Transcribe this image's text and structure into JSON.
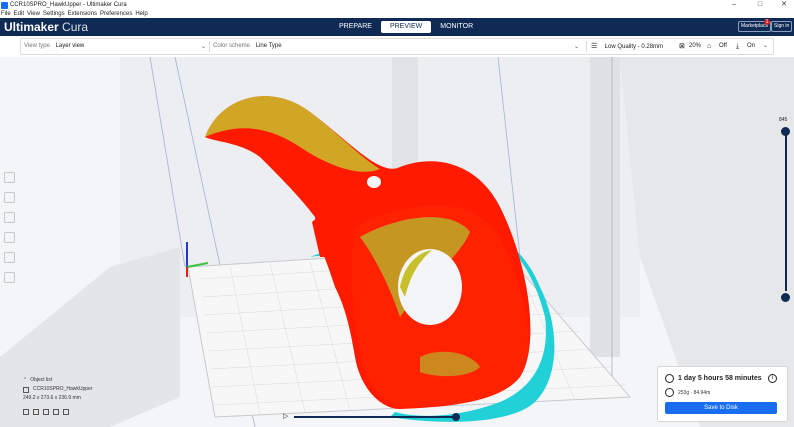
{
  "window": {
    "title": "CCR10SPRO_HawkUpper - Ultimaker Cura",
    "controls": {
      "minimize": "–",
      "maximize": "□",
      "close": "✕"
    }
  },
  "menu": [
    "File",
    "Edit",
    "View",
    "Settings",
    "Extensions",
    "Preferences",
    "Help"
  ],
  "header": {
    "brand_bold": "Ultimaker",
    "brand_thin": "Cura",
    "stages": [
      "PREPARE",
      "PREVIEW",
      "MONITOR"
    ],
    "active_stage": "PREVIEW",
    "marketplace_label": "Marketplace",
    "marketplace_badge": "1",
    "signin_label": "Sign in"
  },
  "toolbar": {
    "view_type_label": "View type",
    "view_type_value": "Layer view",
    "color_scheme_label": "Color scheme",
    "color_scheme_value": "Line Type",
    "quality_label": "Low Quality - 0.28mm",
    "infill_value": "20%",
    "support_value": "Off",
    "adhesion_value": "On"
  },
  "layer_slider": {
    "max_layer": "845",
    "top_fraction": 0.0,
    "bottom_fraction": 1.0
  },
  "playback": {
    "play_icon": "play-icon",
    "progress_fraction": 1.0
  },
  "object_list": {
    "header": "Object list",
    "object_name": "CCR10SPRO_HawkUpper",
    "dimensions": "249.2 x 273.6 x 236.9 mm"
  },
  "print_summary": {
    "time": "1 day 5 hours 58 minutes",
    "material": "253g · 84.94m",
    "save_label": "Save to Disk"
  },
  "colors": {
    "header_bg": "#0e2a55",
    "accent": "#196ef0",
    "model_red": "#ff1a00",
    "model_yellow": "#c8c02a",
    "skirt_cyan": "#22d0d8"
  }
}
